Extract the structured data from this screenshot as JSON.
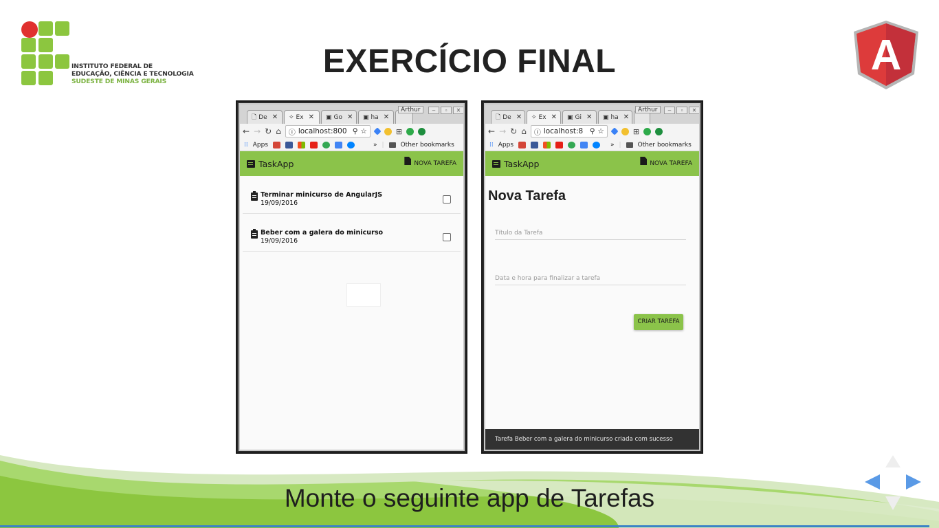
{
  "slide": {
    "title": "EXERCÍCIO FINAL",
    "subtitle": "Monte o seguinte app de Tarefas",
    "logo_lines": [
      "INSTITUTO FEDERAL DE",
      "EDUCAÇÃO, CIÊNCIA E TECNOLOGIA",
      "SUDESTE DE MINAS GERAIS"
    ],
    "logo_angular_letter": "A",
    "colors": {
      "green": "#8bc34a",
      "red": "#e0312f",
      "angular_red": "#dd3b3b",
      "nav_blue": "#5a9ae6"
    }
  },
  "browser_left": {
    "tabs": [
      "De",
      "Ex",
      "Go",
      "ha"
    ],
    "user": "Arthur",
    "url": "localhost:800",
    "bookmarks": {
      "apps": "Apps",
      "more": "»",
      "other": "Other bookmarks"
    },
    "app": {
      "brand": "TaskApp",
      "new_task": "NOVA TAREFA",
      "tasks": [
        {
          "title": "Terminar minicurso de AngularJS",
          "date": "19/09/2016"
        },
        {
          "title": "Beber com a galera do minicurso",
          "date": "19/09/2016"
        }
      ]
    }
  },
  "browser_right": {
    "tabs": [
      "De",
      "Ex",
      "Gi",
      "ha"
    ],
    "user": "Arthur",
    "url": "localhost:8",
    "bookmarks": {
      "apps": "Apps",
      "more": "»",
      "other": "Other bookmarks"
    },
    "app": {
      "brand": "TaskApp",
      "new_task": "NOVA TAREFA",
      "form_title": "Nova Tarefa",
      "title_placeholder": "Título da Tarefa",
      "datetime_placeholder": "Data e hora para finalizar a tarefa",
      "create_button": "CRIAR TAREFA",
      "toast": "Tarefa Beber com a galera do minicurso criada com sucesso"
    }
  }
}
